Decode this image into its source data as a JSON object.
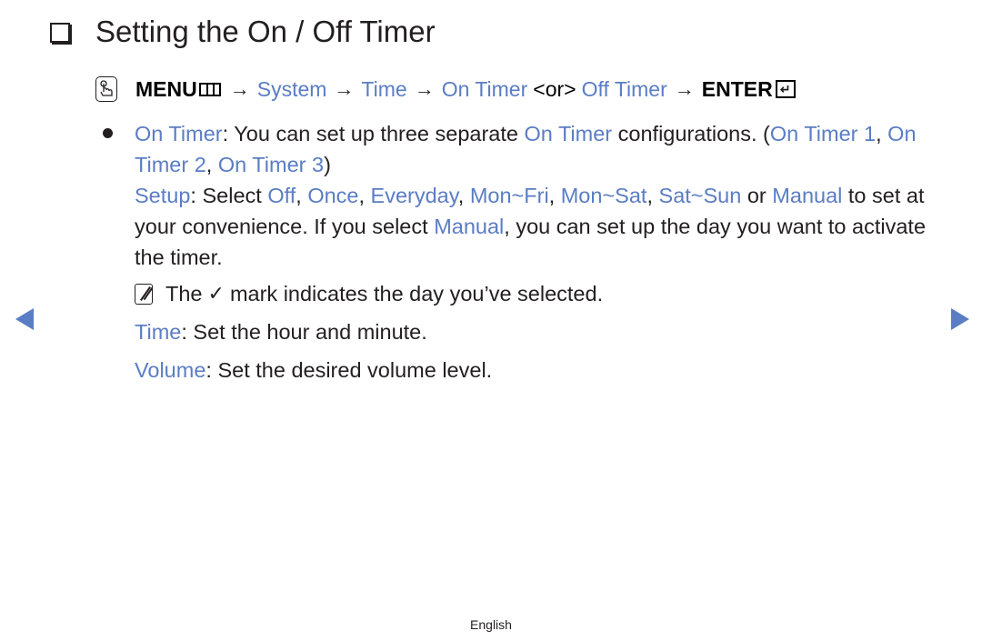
{
  "title": "Setting the On / Off Timer",
  "menu_path": {
    "icon": "om-remote-icon",
    "menu_label": "MENU",
    "menu_icon": "menu-grid-icon",
    "arrow": "→",
    "steps": [
      "System",
      "Time",
      "On Timer"
    ],
    "or_label": "<or>",
    "alt_step": "Off Timer",
    "enter_label": "ENTER",
    "enter_icon": "enter-icon",
    "enter_glyph": "↵"
  },
  "on_timer": {
    "term": "On Timer",
    "text1": ": You can set up three separate ",
    "term2": "On Timer",
    "text2": " configurations. (",
    "items": [
      "On Timer 1",
      "On Timer 2",
      "On Timer 3"
    ],
    "sep": ", ",
    "close": ")"
  },
  "setup": {
    "term": "Setup",
    "text1": ": Select ",
    "options": [
      "Off",
      "Once",
      "Everyday",
      "Mon~Fri",
      "Mon~Sat",
      "Sat~Sun"
    ],
    "sep": ", ",
    "or_text": " or",
    "manual": "Manual",
    "text2": " to set at your convenience. If you select ",
    "manual2": "Manual",
    "text3": ", you can set up the day you want to activate the timer."
  },
  "note": {
    "icon": "note-icon",
    "text1": "The",
    "check": "✓",
    "text2": "mark indicates the day you’ve selected."
  },
  "time": {
    "term": "Time",
    "text": ": Set the hour and minute."
  },
  "volume": {
    "term": "Volume",
    "text": ": Set the desired volume level."
  },
  "nav": {
    "prev": "previous-page",
    "next": "next-page"
  },
  "footer": {
    "language": "English"
  },
  "colors": {
    "accent": "#5a7dc4",
    "text": "#231f20"
  }
}
